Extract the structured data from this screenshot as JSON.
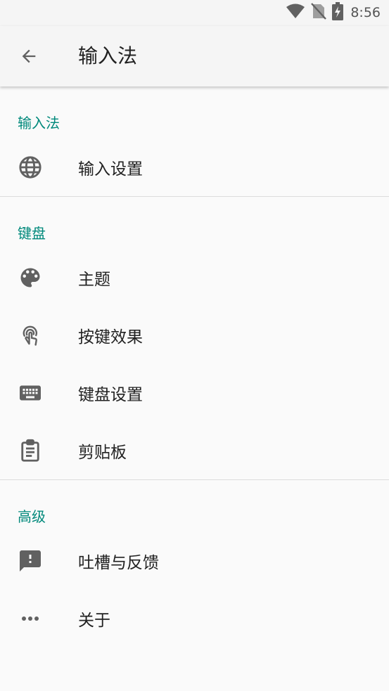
{
  "status_bar": {
    "time": "8:56"
  },
  "app_bar": {
    "title": "输入法"
  },
  "sections": [
    {
      "title": "输入法",
      "items": [
        {
          "label": "输入设置",
          "icon": "globe-icon"
        }
      ]
    },
    {
      "title": "键盘",
      "items": [
        {
          "label": "主题",
          "icon": "palette-icon"
        },
        {
          "label": "按键效果",
          "icon": "touch-icon"
        },
        {
          "label": "键盘设置",
          "icon": "keyboard-icon"
        },
        {
          "label": "剪贴板",
          "icon": "clipboard-icon"
        }
      ]
    },
    {
      "title": "高级",
      "items": [
        {
          "label": "吐槽与反馈",
          "icon": "feedback-icon"
        },
        {
          "label": "关于",
          "icon": "more-icon"
        }
      ]
    }
  ],
  "colors": {
    "accent": "#00897b",
    "icon": "#616161",
    "text": "#212121"
  }
}
